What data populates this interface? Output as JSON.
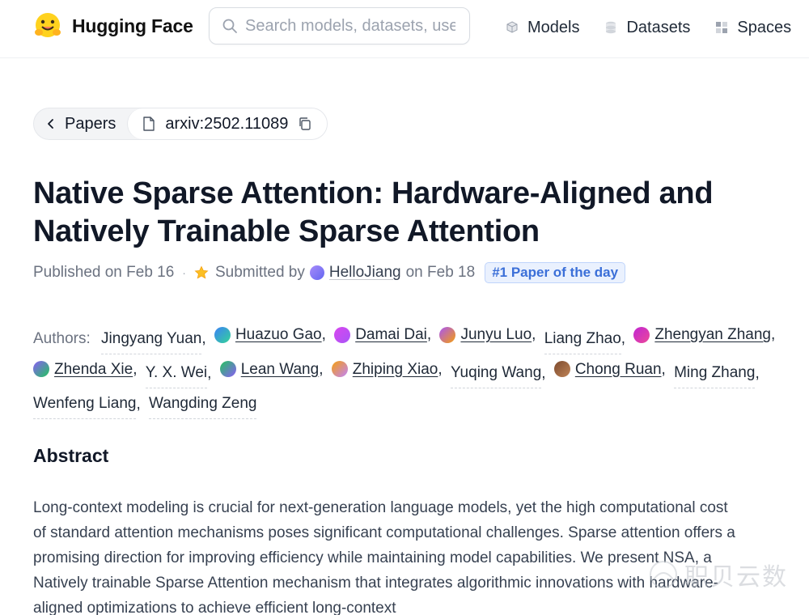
{
  "header": {
    "brand": "Hugging Face",
    "search_placeholder": "Search models, datasets, users...",
    "nav": [
      {
        "label": "Models",
        "icon": "cube-icon"
      },
      {
        "label": "Datasets",
        "icon": "database-icon"
      },
      {
        "label": "Spaces",
        "icon": "grid-icon"
      }
    ]
  },
  "breadcrumb": {
    "back_label": "Papers",
    "paper_id": "arxiv:2502.11089"
  },
  "paper": {
    "title": "Native Sparse Attention: Hardware-Aligned and Natively Trainable Sparse Attention",
    "published": "Published on Feb 16",
    "submitted_prefix": "Submitted by",
    "submitter": "HelloJiang",
    "submitted_date": "on Feb 18",
    "badge": "#1 Paper of the day"
  },
  "authors": {
    "label": "Authors:",
    "list": [
      {
        "name": "Jingyang Yuan",
        "linked": false,
        "avatar": ""
      },
      {
        "name": "Huazuo Gao",
        "linked": true,
        "avatar": "#3b82f6,#34d399"
      },
      {
        "name": "Damai Dai",
        "linked": true,
        "avatar": "#d946ef,#a855f7"
      },
      {
        "name": "Junyu Luo",
        "linked": true,
        "avatar": "#a855f7,#f59e0b"
      },
      {
        "name": "Liang Zhao",
        "linked": false,
        "avatar": ""
      },
      {
        "name": "Zhengyan Zhang",
        "linked": true,
        "avatar": "#c026d3,#ec4899"
      },
      {
        "name": "Zhenda Xie",
        "linked": true,
        "avatar": "#8b5cf6,#22c55e"
      },
      {
        "name": "Y. X. Wei",
        "linked": false,
        "avatar": ""
      },
      {
        "name": "Lean Wang",
        "linked": true,
        "avatar": "#22c55e,#8b5cf6"
      },
      {
        "name": "Zhiping Xiao",
        "linked": true,
        "avatar": "#f59e0b,#c084fc"
      },
      {
        "name": "Yuqing Wang",
        "linked": false,
        "avatar": ""
      },
      {
        "name": "Chong Ruan",
        "linked": true,
        "avatar": "#7c4a2d,#c08457"
      },
      {
        "name": "Ming Zhang",
        "linked": false,
        "avatar": ""
      },
      {
        "name": "Wenfeng Liang",
        "linked": false,
        "avatar": ""
      },
      {
        "name": "Wangding Zeng",
        "linked": false,
        "avatar": ""
      }
    ]
  },
  "abstract": {
    "heading": "Abstract",
    "text": "Long-context modeling is crucial for next-generation language models, yet the high computational cost of standard attention mechanisms poses significant computational challenges. Sparse attention offers a promising direction for improving efficiency while maintaining model capabilities. We present NSA, a Natively trainable Sparse Attention mechanism that integrates algorithmic innovations with hardware-aligned optimizations to achieve efficient long-context"
  },
  "watermark": {
    "text": "职贝云数"
  },
  "colors": {
    "badge_bg": "#eaf1fe",
    "badge_text": "#3b6fd8",
    "logo_yellow": "#FFD21E"
  }
}
